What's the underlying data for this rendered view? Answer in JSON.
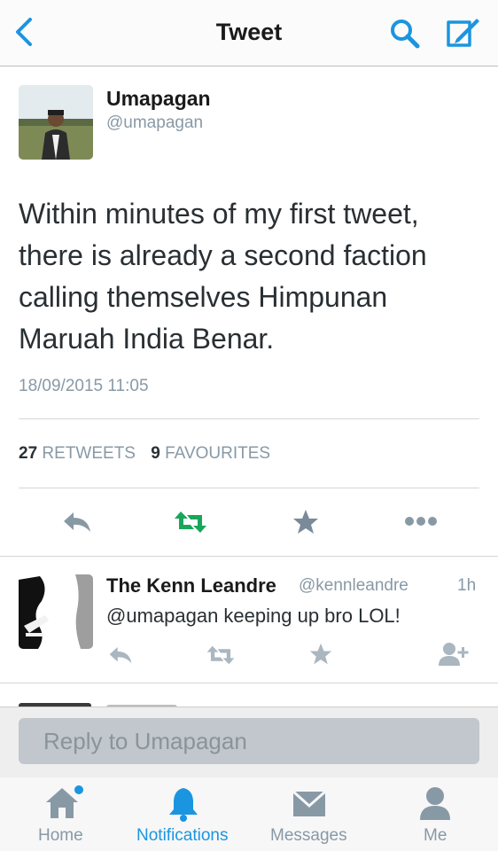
{
  "header": {
    "title": "Tweet",
    "back_icon": "back-chevron-icon",
    "search_icon": "search-icon",
    "compose_icon": "compose-icon"
  },
  "tweet": {
    "author_name": "Umapagan",
    "author_handle": "@umapagan",
    "text": "Within minutes of my first tweet, there is already a second faction calling themselves Himpunan Maruah India Benar.",
    "timestamp": "18/09/2015 11:05",
    "retweets_count": "27",
    "retweets_label": "RETWEETS",
    "favourites_count": "9",
    "favourites_label": "FAVOURITES"
  },
  "reply": {
    "name": "The Kenn Leandre",
    "handle": "@kennleandre",
    "time": "1h",
    "text": "@umapagan keeping up bro LOL!"
  },
  "reply_bar": {
    "placeholder": "Reply to Umapagan"
  },
  "tabs": [
    {
      "label": "Home",
      "icon": "home-icon",
      "active": false,
      "has_badge": true
    },
    {
      "label": "Notifications",
      "icon": "bell-icon",
      "active": true
    },
    {
      "label": "Messages",
      "icon": "envelope-icon",
      "active": false
    },
    {
      "label": "Me",
      "icon": "person-icon",
      "active": false
    }
  ],
  "colors": {
    "accent": "#1b95e0",
    "retweet_green": "#19a65b",
    "muted": "#8899a6",
    "text": "#292f33"
  }
}
